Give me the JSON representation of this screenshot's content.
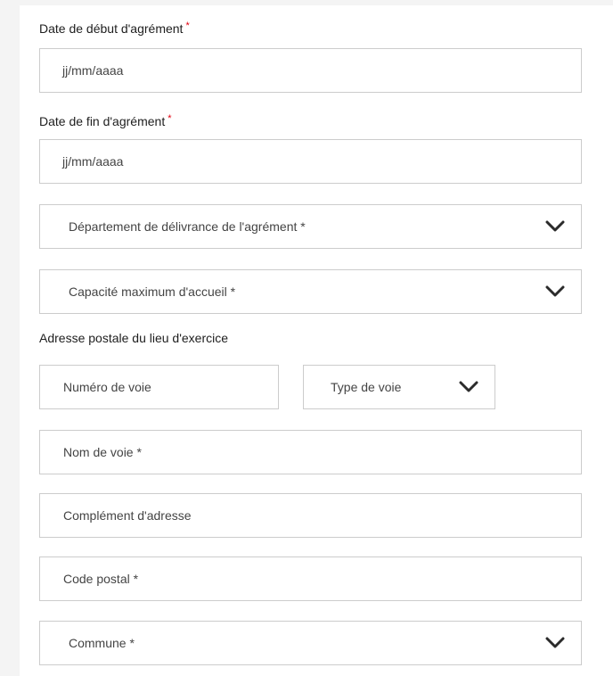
{
  "fields": {
    "date_debut": {
      "label": "Date de début d'agrément",
      "required_mark": "*",
      "placeholder": "jj/mm/aaaa"
    },
    "date_fin": {
      "label": "Date de fin d'agrément",
      "required_mark": "*",
      "placeholder": "jj/mm/aaaa"
    },
    "departement": {
      "placeholder": "Département de délivrance de l'agrément *",
      "icon": "chevron-down-icon"
    },
    "capacite": {
      "placeholder": "Capacité maximum d'accueil *",
      "icon": "chevron-down-icon"
    }
  },
  "address": {
    "section_label": "Adresse postale du lieu d'exercice",
    "numero_voie": {
      "placeholder": "Numéro de voie"
    },
    "type_voie": {
      "placeholder": "Type de voie",
      "icon": "chevron-down-icon"
    },
    "nom_voie": {
      "placeholder": "Nom de voie *"
    },
    "complement": {
      "placeholder": "Complément d'adresse"
    },
    "code_postal": {
      "placeholder": "Code postal *"
    },
    "commune": {
      "placeholder": "Commune *",
      "icon": "chevron-down-icon"
    }
  },
  "colors": {
    "required": "#e1000f",
    "border": "#cccccc",
    "chevron": "#2b2b2b"
  }
}
